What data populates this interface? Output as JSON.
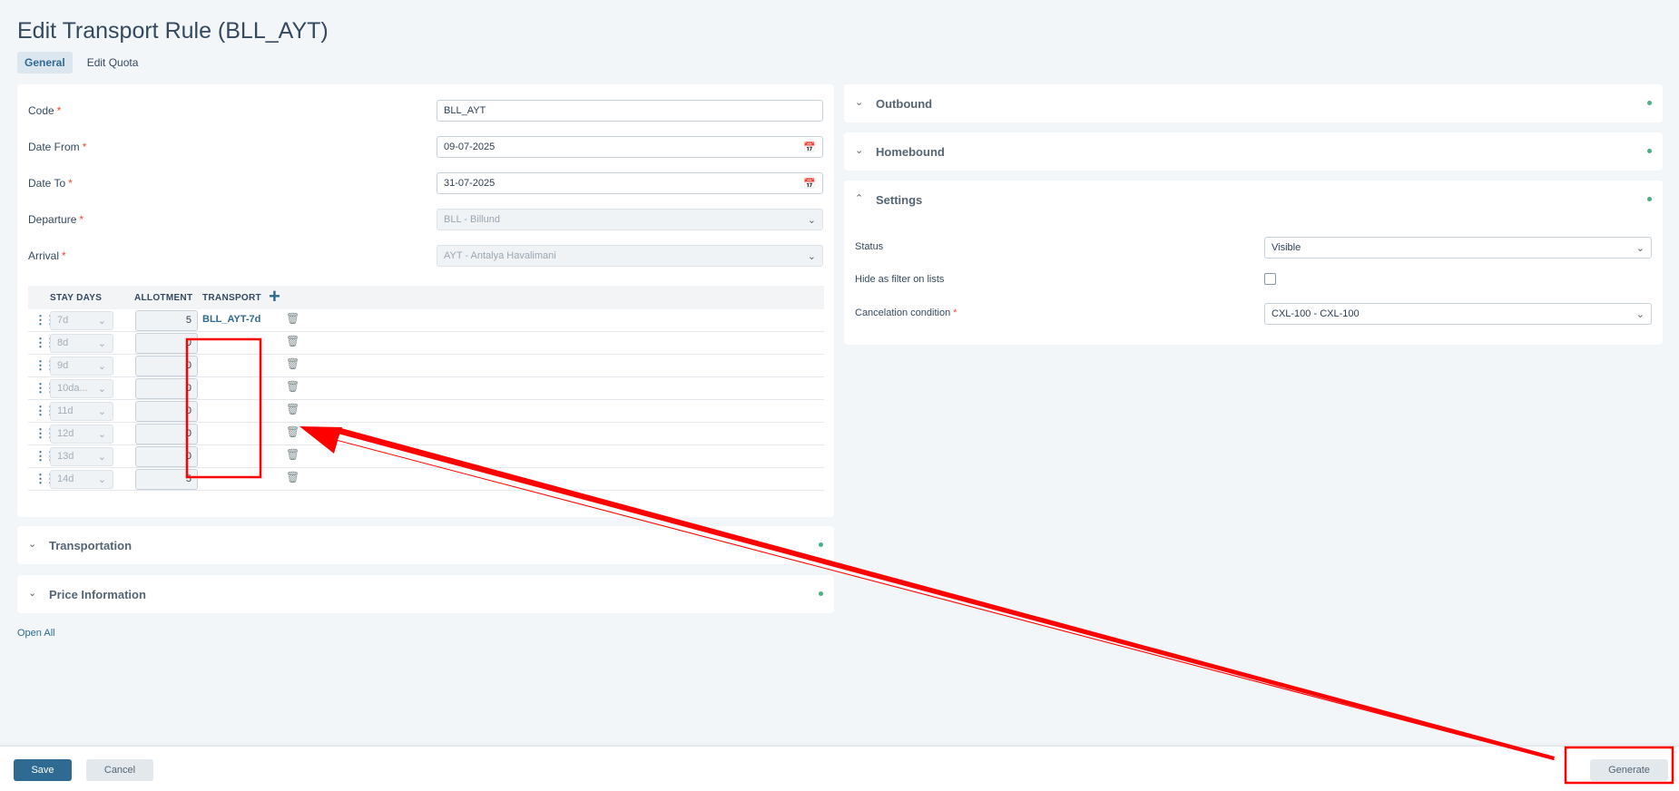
{
  "page": {
    "title": "Edit Transport Rule (BLL_AYT)"
  },
  "tabs": [
    {
      "label": "General",
      "active": true
    },
    {
      "label": "Edit Quota",
      "active": false
    }
  ],
  "form": {
    "required_marker": "*",
    "code": {
      "label": "Code",
      "value": "BLL_AYT"
    },
    "date_from": {
      "label": "Date From",
      "value": "09-07-2025"
    },
    "date_to": {
      "label": "Date To",
      "value": "31-07-2025"
    },
    "departure": {
      "label": "Departure",
      "value": "BLL - Billund"
    },
    "arrival": {
      "label": "Arrival",
      "value": "AYT - Antalya Havalimani"
    }
  },
  "stay_table": {
    "headers": {
      "stay_days": "STAY DAYS",
      "allotment": "ALLOTMENT",
      "transport": "TRANSPORT"
    },
    "rows": [
      {
        "stay": "7d",
        "allotment": "5",
        "transport": "BLL_AYT-7d"
      },
      {
        "stay": "8d",
        "allotment": "0",
        "transport": ""
      },
      {
        "stay": "9d",
        "allotment": "0",
        "transport": ""
      },
      {
        "stay": "10da...",
        "allotment": "0",
        "transport": ""
      },
      {
        "stay": "11d",
        "allotment": "0",
        "transport": ""
      },
      {
        "stay": "12d",
        "allotment": "0",
        "transport": ""
      },
      {
        "stay": "13d",
        "allotment": "0",
        "transport": ""
      },
      {
        "stay": "14d",
        "allotment": "5",
        "transport": ""
      }
    ]
  },
  "left_sections": [
    {
      "title": "Transportation"
    },
    {
      "title": "Price Information"
    }
  ],
  "open_all": "Open All",
  "right_sections": {
    "outbound": "Outbound",
    "homebound": "Homebound",
    "settings": "Settings"
  },
  "settings": {
    "status": {
      "label": "Status",
      "value": "Visible"
    },
    "hide_filter": {
      "label": "Hide as filter on lists",
      "checked": false
    },
    "cancelation": {
      "label": "Cancelation condition",
      "value": "CXL-100 - CXL-100"
    }
  },
  "footer": {
    "save": "Save",
    "cancel": "Cancel",
    "generate": "Generate"
  },
  "colors": {
    "primary": "#2e6a92",
    "required": "#e74c3c",
    "status_dot": "#48b083",
    "annotation": "#ff0000"
  },
  "icons": [
    "calendar-icon",
    "chevron-down-icon",
    "chevron-up-icon",
    "plus-icon",
    "drag-handle-icon",
    "trash-icon"
  ]
}
